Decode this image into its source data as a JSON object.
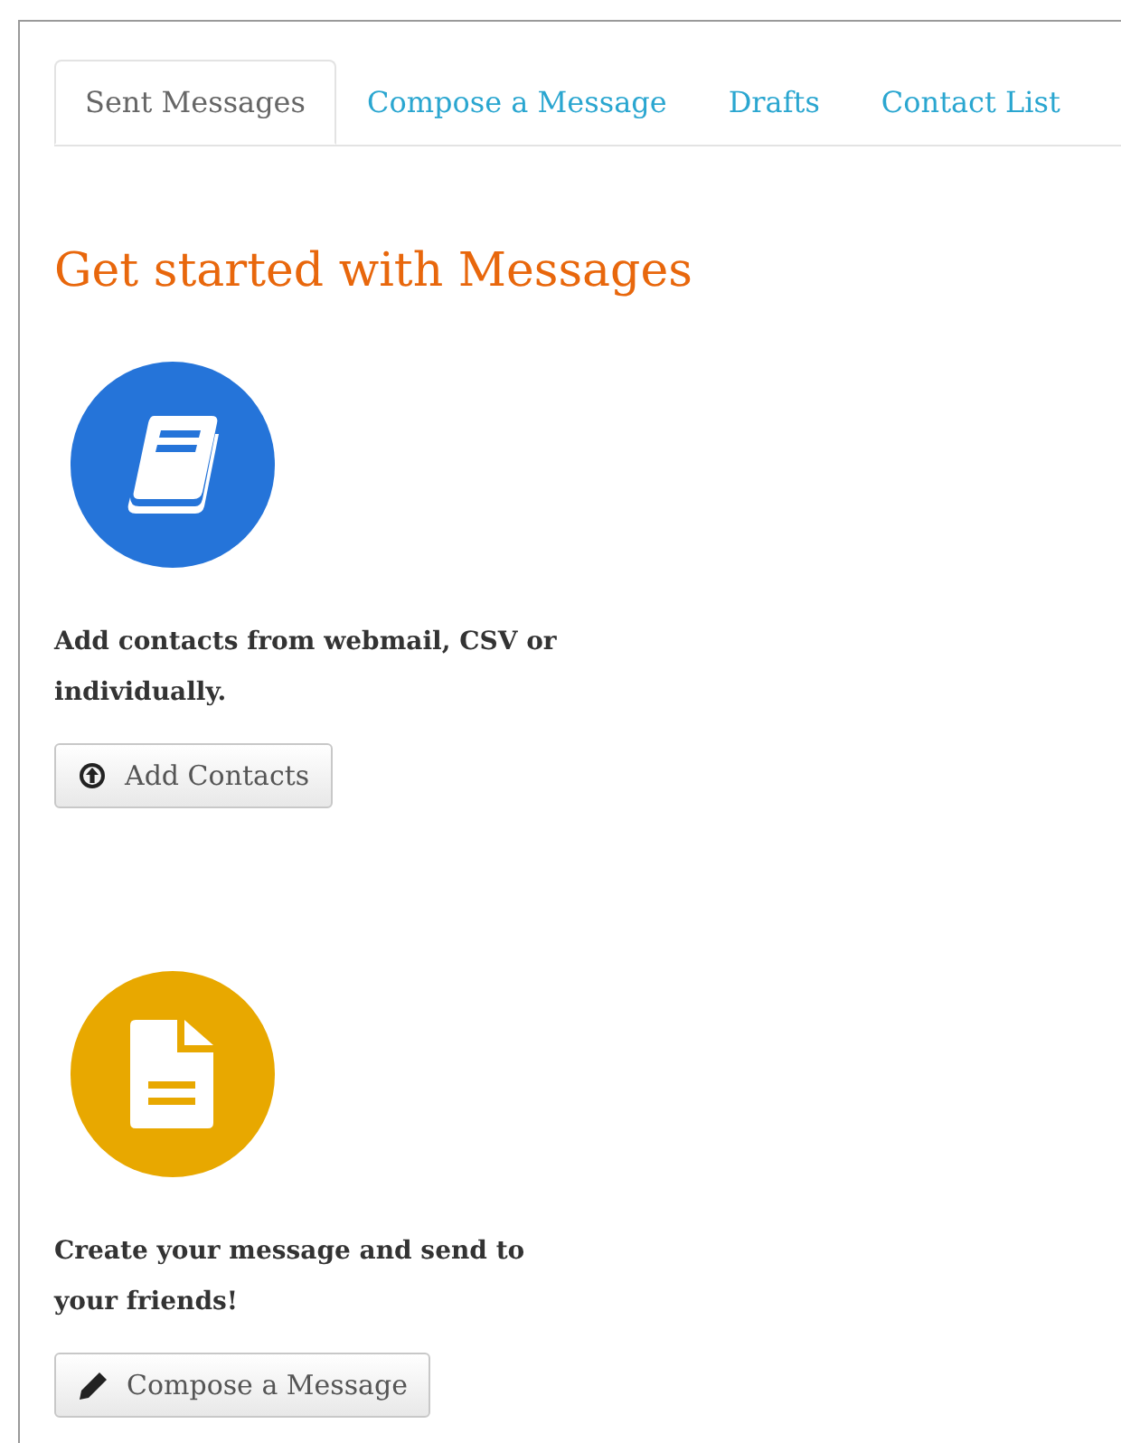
{
  "tabs": [
    {
      "label": "Sent Messages",
      "selected": true
    },
    {
      "label": "Compose a Message",
      "selected": false
    },
    {
      "label": "Drafts",
      "selected": false
    },
    {
      "label": "Contact List",
      "selected": false
    }
  ],
  "heading": "Get started with Messages",
  "sections": [
    {
      "kind": "contacts",
      "color": "#2574d9",
      "text": "Add contacts from webmail, CSV or individually.",
      "button": {
        "label": "Add Contacts"
      }
    },
    {
      "kind": "compose",
      "color": "#e8a800",
      "text": "Create your message and send to your friends!",
      "button": {
        "label": "Compose a Message"
      }
    }
  ]
}
